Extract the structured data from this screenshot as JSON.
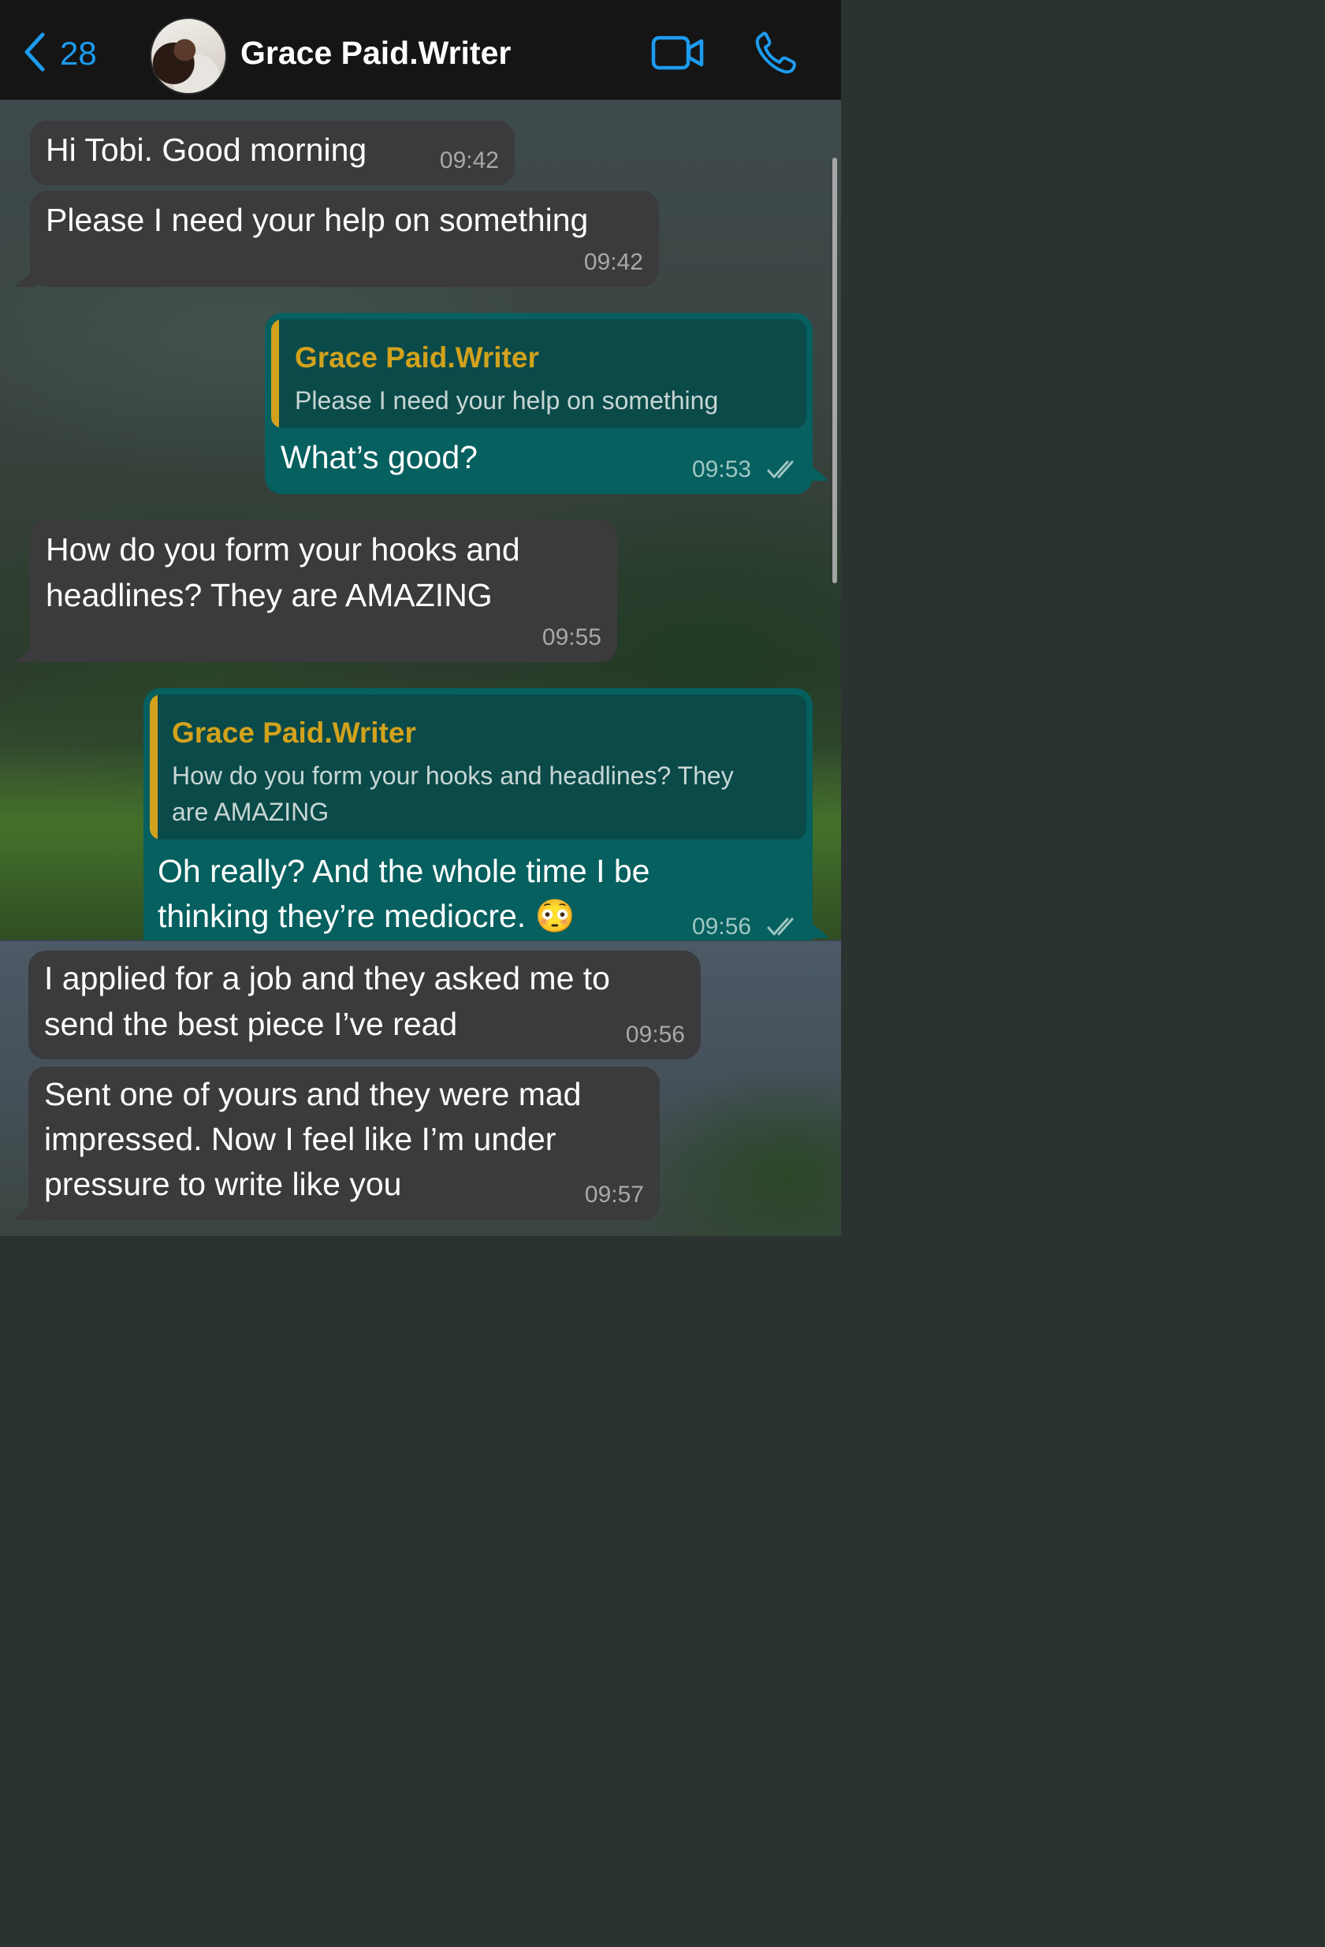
{
  "header": {
    "back_count": "28",
    "contact_name": "Grace Paid.Writer",
    "icons": [
      "chevron-left-icon",
      "video-call-icon",
      "phone-call-icon"
    ],
    "accent_color": "#1d9bf0"
  },
  "messages": [
    {
      "direction": "incoming",
      "text": "Hi Tobi. Good morning",
      "time": "09:42"
    },
    {
      "direction": "incoming",
      "text": "Please I need your help on something",
      "time": "09:42"
    },
    {
      "direction": "outgoing",
      "quote": {
        "author": "Grace Paid.Writer",
        "text": "Please I need your help on something"
      },
      "text": "What’s good?",
      "time": "09:53",
      "status": "read"
    },
    {
      "direction": "incoming",
      "lines": [
        "How do you form your hooks and",
        "headlines? They are AMAZING"
      ],
      "time": "09:55"
    },
    {
      "direction": "outgoing",
      "quote": {
        "author": "Grace Paid.Writer",
        "lines": [
          "How do you form your hooks and headlines? They",
          "are AMAZING"
        ]
      },
      "lines": [
        "Oh really? And the whole time I be",
        "thinking they’re mediocre. 😳"
      ],
      "time": "09:56",
      "status": "read"
    },
    {
      "direction": "incoming",
      "lines": [
        "I applied for a job and they asked me to",
        "send the best piece I’ve read"
      ],
      "time": "09:56"
    },
    {
      "direction": "incoming",
      "lines": [
        "Sent one of yours and they were mad",
        "impressed. Now I feel like I’m under",
        "pressure to write like you"
      ],
      "time": "09:57"
    }
  ],
  "colors": {
    "incoming_bubble": "#3b3b3d",
    "outgoing_bubble": "#05605f",
    "quote_author": "#d2a21d"
  }
}
